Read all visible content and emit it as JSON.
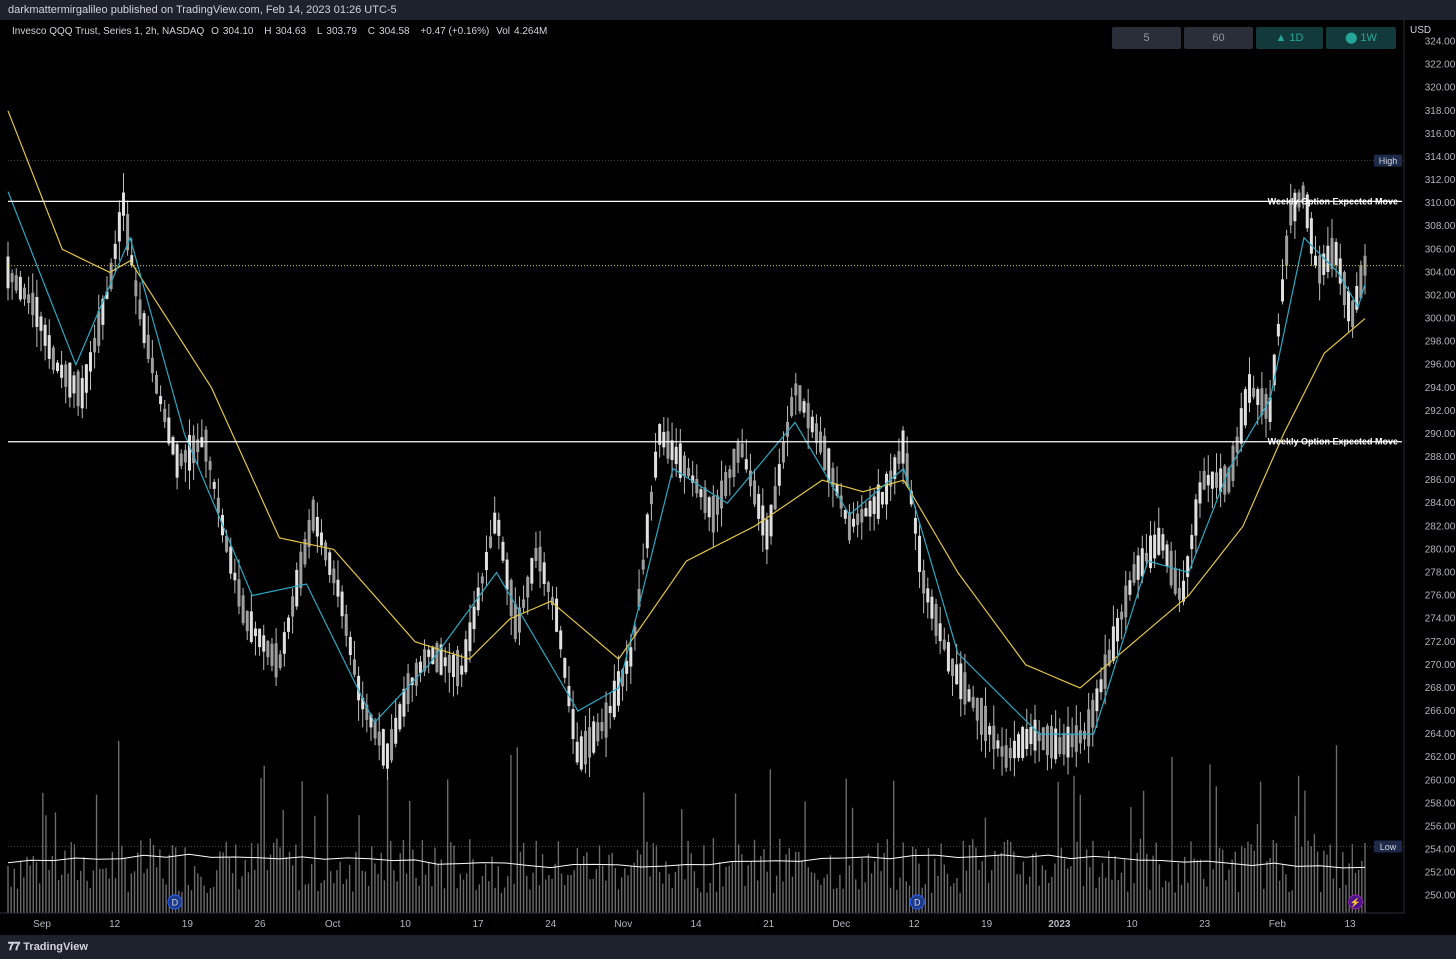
{
  "publisher_line": "darkmattermirgalileo published on TradingView.com, Feb 14, 2023 01:26 UTC-5",
  "legend": {
    "symbol": "Invesco QQQ Trust, Series 1, 2h, NASDAQ",
    "open_label": "O",
    "open": "304.10",
    "high_label": "H",
    "high": "304.63",
    "low_label": "L",
    "low": "303.79",
    "close_label": "C",
    "close": "304.58",
    "change": "+0.47 (+0.16%)",
    "vol_label": "Vol",
    "vol": "4.264M"
  },
  "timeframes": [
    {
      "label": "5",
      "style": "grey"
    },
    {
      "label": "60",
      "style": "grey"
    },
    {
      "label": "▲ 1D",
      "style": "teal"
    },
    {
      "label": "⬤ 1W",
      "style": "teal"
    }
  ],
  "currency": "USD",
  "footer": {
    "brand": "TradingView",
    "logo": "tradingview-logo"
  },
  "colors": {
    "background": "#000000",
    "candle": "#d9d9d9",
    "ema_fast": "#2aa9c4",
    "ema_slow": "#e3c542",
    "volume": "#6b6b6b",
    "vol_ma": "#ffffff",
    "last_price": "#ffeb3b"
  },
  "chart_data": {
    "type": "candlestick",
    "interval": "2h",
    "y_ticks": [
      "324.00",
      "322.00",
      "320.00",
      "318.00",
      "316.00",
      "314.00",
      "312.00",
      "310.00",
      "308.00",
      "306.00",
      "304.00",
      "302.00",
      "300.00",
      "298.00",
      "296.00",
      "294.00",
      "292.00",
      "290.00",
      "288.00",
      "286.00",
      "284.00",
      "282.00",
      "280.00",
      "278.00",
      "276.00",
      "274.00",
      "272.00",
      "270.00",
      "268.00",
      "266.00",
      "264.00",
      "262.00",
      "260.00",
      "258.00",
      "256.00",
      "254.00",
      "252.00",
      "250.00"
    ],
    "ylim": [
      248.5,
      325
    ],
    "x_ticks": [
      "Sep",
      "12",
      "19",
      "26",
      "Oct",
      "10",
      "17",
      "24",
      "Nov",
      "14",
      "21",
      "Dec",
      "12",
      "19",
      "2023",
      "10",
      "23",
      "Feb",
      "13"
    ],
    "bold_x_ticks": [
      "2023"
    ],
    "events": [
      {
        "label": "D",
        "at": "19"
      },
      {
        "label": "D",
        "at": "19"
      },
      {
        "label": "⚡",
        "at": "13"
      }
    ],
    "price_lines": [
      {
        "label": "Weekly Option Expected Move",
        "value": 310.15,
        "value_text": "310.15",
        "style": "solid"
      },
      {
        "label": "Weekly Option Expected Move",
        "value": 289.33,
        "value_text": "289.33",
        "style": "solid"
      }
    ],
    "markers": [
      {
        "label": "High",
        "value": 313.68,
        "value_text": "313.68"
      },
      {
        "label": "Low",
        "value": 254.26,
        "value_text": "254.26"
      },
      {
        "label": "",
        "value": 304.58,
        "value_text": "304.58"
      }
    ],
    "price_path": [
      {
        "t": 0,
        "p": 304.0
      },
      {
        "t": 0.02,
        "p": 301.0
      },
      {
        "t": 0.035,
        "p": 296.0
      },
      {
        "t": 0.055,
        "p": 293.5
      },
      {
        "t": 0.075,
        "p": 303.0
      },
      {
        "t": 0.085,
        "p": 310.0
      },
      {
        "t": 0.095,
        "p": 302.0
      },
      {
        "t": 0.11,
        "p": 294.0
      },
      {
        "t": 0.125,
        "p": 287.5
      },
      {
        "t": 0.145,
        "p": 289.5
      },
      {
        "t": 0.16,
        "p": 281.0
      },
      {
        "t": 0.175,
        "p": 274.0
      },
      {
        "t": 0.2,
        "p": 270.0
      },
      {
        "t": 0.225,
        "p": 283.0
      },
      {
        "t": 0.245,
        "p": 276.0
      },
      {
        "t": 0.26,
        "p": 267.0
      },
      {
        "t": 0.28,
        "p": 262.0
      },
      {
        "t": 0.295,
        "p": 268.0
      },
      {
        "t": 0.31,
        "p": 271.0
      },
      {
        "t": 0.335,
        "p": 269.5
      },
      {
        "t": 0.36,
        "p": 283.0
      },
      {
        "t": 0.375,
        "p": 273.0
      },
      {
        "t": 0.39,
        "p": 280.0
      },
      {
        "t": 0.405,
        "p": 274.0
      },
      {
        "t": 0.42,
        "p": 262.0
      },
      {
        "t": 0.44,
        "p": 265.0
      },
      {
        "t": 0.46,
        "p": 271.0
      },
      {
        "t": 0.48,
        "p": 290.0
      },
      {
        "t": 0.5,
        "p": 287.0
      },
      {
        "t": 0.52,
        "p": 283.0
      },
      {
        "t": 0.54,
        "p": 289.0
      },
      {
        "t": 0.56,
        "p": 281.0
      },
      {
        "t": 0.58,
        "p": 294.0
      },
      {
        "t": 0.6,
        "p": 289.0
      },
      {
        "t": 0.62,
        "p": 282.0
      },
      {
        "t": 0.645,
        "p": 284.5
      },
      {
        "t": 0.66,
        "p": 289.0
      },
      {
        "t": 0.675,
        "p": 277.0
      },
      {
        "t": 0.695,
        "p": 270.0
      },
      {
        "t": 0.715,
        "p": 266.0
      },
      {
        "t": 0.735,
        "p": 262.0
      },
      {
        "t": 0.755,
        "p": 264.0
      },
      {
        "t": 0.775,
        "p": 263.0
      },
      {
        "t": 0.795,
        "p": 264.0
      },
      {
        "t": 0.81,
        "p": 270.0
      },
      {
        "t": 0.83,
        "p": 278.0
      },
      {
        "t": 0.85,
        "p": 281.0
      },
      {
        "t": 0.865,
        "p": 275.5
      },
      {
        "t": 0.88,
        "p": 286.0
      },
      {
        "t": 0.9,
        "p": 286.0
      },
      {
        "t": 0.915,
        "p": 294.0
      },
      {
        "t": 0.93,
        "p": 292.0
      },
      {
        "t": 0.945,
        "p": 309.0
      },
      {
        "t": 0.955,
        "p": 311.0
      },
      {
        "t": 0.965,
        "p": 304.0
      },
      {
        "t": 0.978,
        "p": 306.0
      },
      {
        "t": 0.99,
        "p": 300.0
      },
      {
        "t": 1.0,
        "p": 304.58
      }
    ],
    "ema_fast_path": [
      {
        "t": 0,
        "p": 311.0
      },
      {
        "t": 0.05,
        "p": 296.0
      },
      {
        "t": 0.09,
        "p": 307.0
      },
      {
        "t": 0.13,
        "p": 290.0
      },
      {
        "t": 0.18,
        "p": 276.0
      },
      {
        "t": 0.22,
        "p": 277.0
      },
      {
        "t": 0.27,
        "p": 265.0
      },
      {
        "t": 0.31,
        "p": 270.0
      },
      {
        "t": 0.36,
        "p": 278.0
      },
      {
        "t": 0.42,
        "p": 266.0
      },
      {
        "t": 0.45,
        "p": 268.0
      },
      {
        "t": 0.49,
        "p": 287.0
      },
      {
        "t": 0.53,
        "p": 284.0
      },
      {
        "t": 0.58,
        "p": 291.0
      },
      {
        "t": 0.62,
        "p": 283.0
      },
      {
        "t": 0.66,
        "p": 287.0
      },
      {
        "t": 0.7,
        "p": 271.0
      },
      {
        "t": 0.76,
        "p": 264.0
      },
      {
        "t": 0.8,
        "p": 264.0
      },
      {
        "t": 0.84,
        "p": 279.0
      },
      {
        "t": 0.87,
        "p": 278.0
      },
      {
        "t": 0.9,
        "p": 287.0
      },
      {
        "t": 0.93,
        "p": 293.0
      },
      {
        "t": 0.955,
        "p": 307.0
      },
      {
        "t": 0.98,
        "p": 304.0
      },
      {
        "t": 0.995,
        "p": 301.0
      },
      {
        "t": 1.0,
        "p": 303.0
      }
    ],
    "ema_slow_path": [
      {
        "t": 0,
        "p": 318.0
      },
      {
        "t": 0.04,
        "p": 306.0
      },
      {
        "t": 0.075,
        "p": 304.0
      },
      {
        "t": 0.09,
        "p": 305.0
      },
      {
        "t": 0.15,
        "p": 294.0
      },
      {
        "t": 0.2,
        "p": 281.0
      },
      {
        "t": 0.24,
        "p": 280.0
      },
      {
        "t": 0.3,
        "p": 272.0
      },
      {
        "t": 0.34,
        "p": 270.5
      },
      {
        "t": 0.37,
        "p": 274.0
      },
      {
        "t": 0.4,
        "p": 275.5
      },
      {
        "t": 0.45,
        "p": 270.5
      },
      {
        "t": 0.5,
        "p": 279.0
      },
      {
        "t": 0.55,
        "p": 282.0
      },
      {
        "t": 0.6,
        "p": 286.0
      },
      {
        "t": 0.63,
        "p": 285.0
      },
      {
        "t": 0.66,
        "p": 286.0
      },
      {
        "t": 0.7,
        "p": 278.0
      },
      {
        "t": 0.75,
        "p": 270.0
      },
      {
        "t": 0.79,
        "p": 268.0
      },
      {
        "t": 0.83,
        "p": 272.0
      },
      {
        "t": 0.87,
        "p": 276.0
      },
      {
        "t": 0.91,
        "p": 282.0
      },
      {
        "t": 0.94,
        "p": 290.0
      },
      {
        "t": 0.97,
        "p": 297.0
      },
      {
        "t": 1.0,
        "p": 300.0
      }
    ]
  }
}
